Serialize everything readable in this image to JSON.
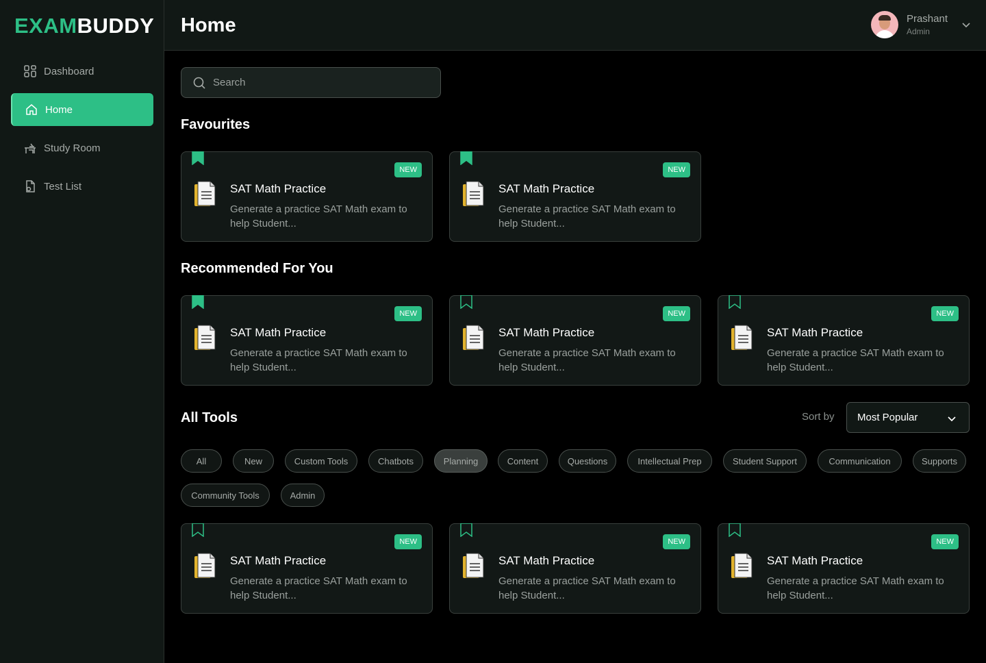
{
  "brand": {
    "part1": "EXAM",
    "part2": "BUDDY"
  },
  "nav": [
    {
      "label": "Dashboard",
      "icon": "grid-icon"
    },
    {
      "label": "Home",
      "icon": "home-icon",
      "active": true
    },
    {
      "label": "Study Room",
      "icon": "desk-icon"
    },
    {
      "label": "Test List",
      "icon": "file-lock-icon"
    }
  ],
  "header": {
    "title": "Home"
  },
  "user": {
    "name": "Prashant",
    "role": "Admin"
  },
  "search": {
    "placeholder": "Search"
  },
  "sections": {
    "favourites": "Favourites",
    "recommended": "Recommended For You",
    "all_tools": "All Tools"
  },
  "card": {
    "badge": "NEW",
    "title": "SAT Math Practice",
    "desc": "Generate a practice SAT Math exam to help Student..."
  },
  "sort": {
    "label": "Sort by",
    "value": "Most Popular"
  },
  "chips": [
    "All",
    "New",
    "Custom Tools",
    "Chatbots",
    "Planning",
    "Content",
    "Questions",
    "Intellectual Prep",
    "Student Support",
    "Communication",
    "Supports",
    "Community Tools",
    "Admin"
  ],
  "selected_chip": "Planning",
  "colors": {
    "accent": "#2dbf86",
    "background": "#000000",
    "panel": "#111815"
  }
}
